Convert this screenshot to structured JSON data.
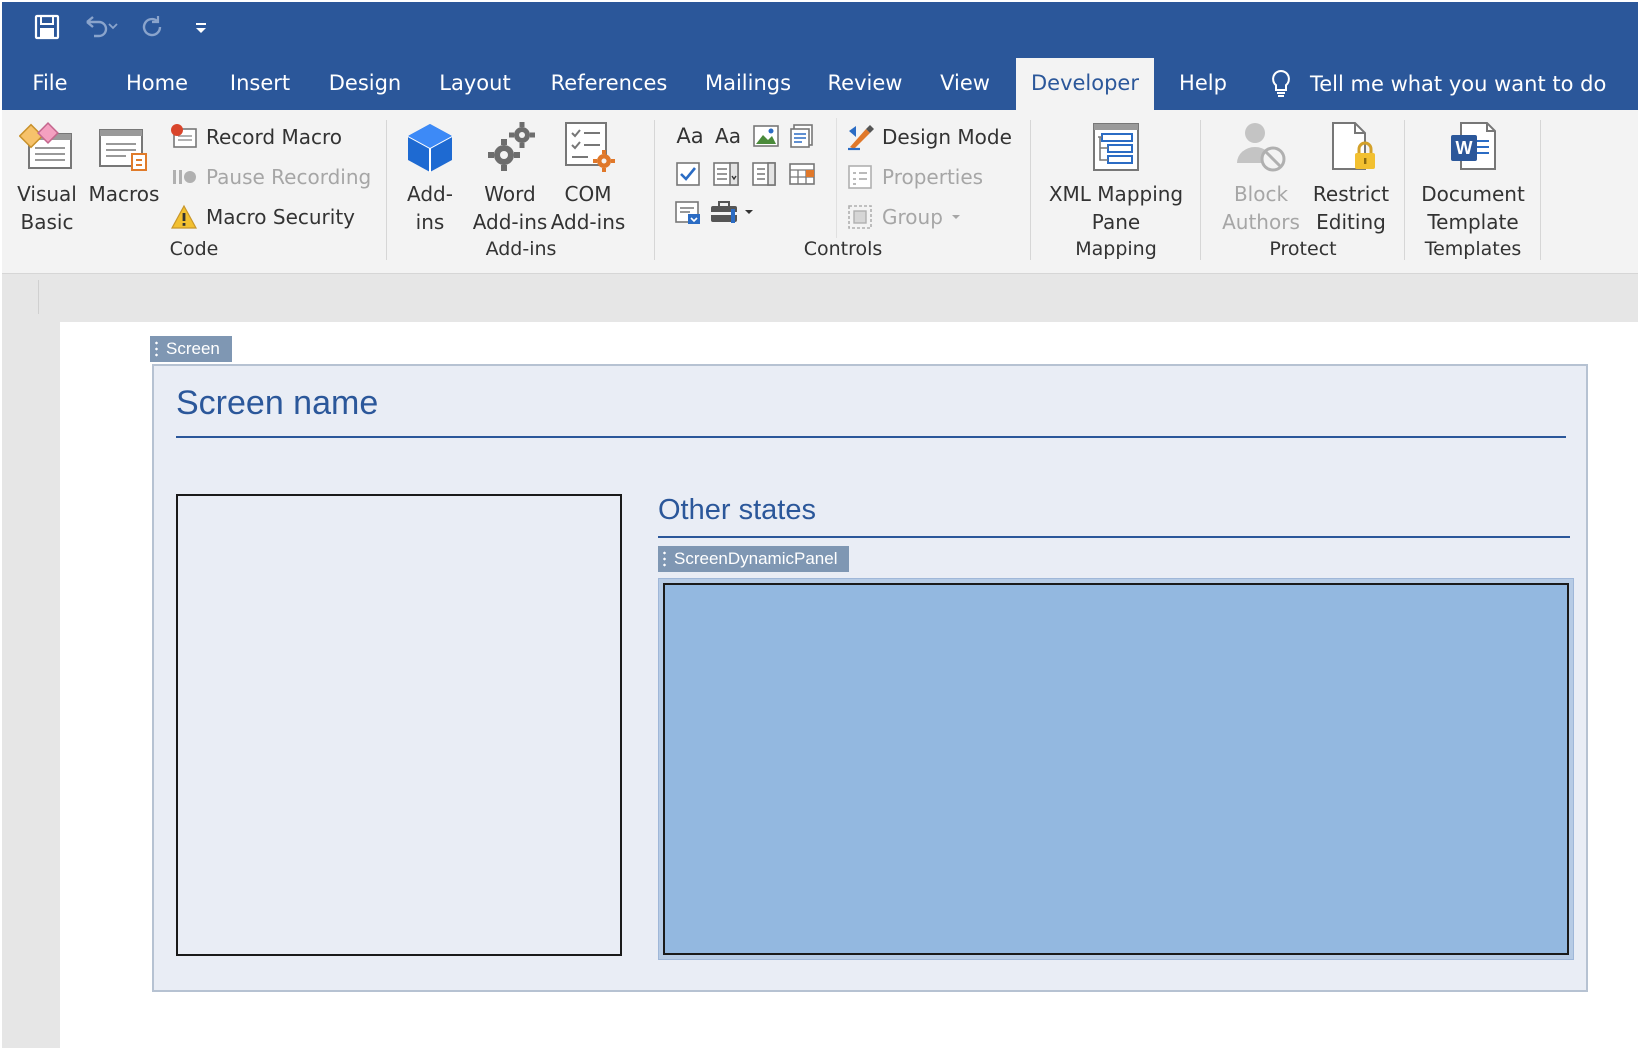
{
  "qat": {
    "save_icon": "save-icon",
    "undo_icon": "undo-icon",
    "redo_icon": "redo-icon",
    "customize_icon": "customize-qat-icon"
  },
  "tabs": {
    "file": "File",
    "home": "Home",
    "insert": "Insert",
    "design": "Design",
    "layout": "Layout",
    "references": "References",
    "mailings": "Mailings",
    "review": "Review",
    "view": "View",
    "developer": "Developer",
    "help": "Help",
    "tell_me": "Tell me what you want to do"
  },
  "ribbon": {
    "code": {
      "label": "Code",
      "visual_basic": "Visual\nBasic",
      "macros": "Macros",
      "record_macro": "Record Macro",
      "pause_recording": "Pause Recording",
      "macro_security": "Macro Security"
    },
    "addins": {
      "label": "Add-ins",
      "addins": "Add-\nins",
      "word_addins": "Word\nAdd-ins",
      "com_addins": "COM\nAdd-ins"
    },
    "controls": {
      "label": "Controls",
      "rich_text": "Aa",
      "plain_text": "Aa",
      "design_mode": "Design Mode",
      "properties": "Properties",
      "group": "Group"
    },
    "mapping": {
      "label": "Mapping",
      "xml_pane": "XML Mapping\nPane"
    },
    "protect": {
      "label": "Protect",
      "block_authors": "Block\nAuthors",
      "restrict_editing": "Restrict\nEditing"
    },
    "templates": {
      "label": "Templates",
      "document_template": "Document\nTemplate"
    }
  },
  "document": {
    "screen_tag": "Screen",
    "screen_name": "Screen name",
    "other_states": "Other states",
    "dynamic_panel_tag": "ScreenDynamicPanel"
  },
  "colors": {
    "accent": "#2b579a",
    "ribbon_bg": "#f3f3f3",
    "panel_fill": "#93b8e0",
    "screen_bg": "#e9edf5"
  }
}
